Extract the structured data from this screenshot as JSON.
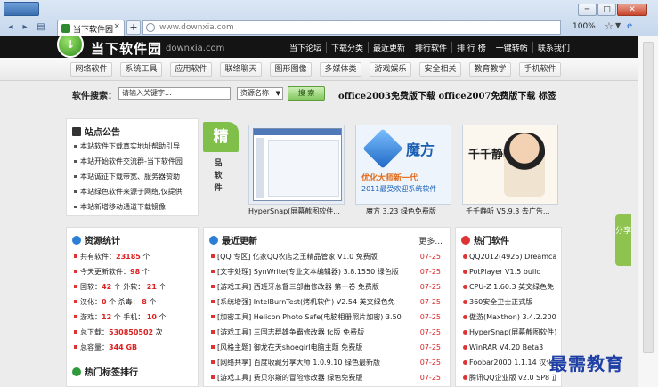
{
  "browser": {
    "tab_title": "当下软件园",
    "tab_close": "×",
    "new_tab": "+",
    "url": "www.downxia.com",
    "zoom": "100%",
    "back_icon": "◂",
    "forward_icon": "▸",
    "window_min": "─",
    "window_max": "□",
    "window_close": "✕"
  },
  "header": {
    "logo_text": "当下软件园",
    "logo_domain": "downxia.com",
    "nav": [
      "当下论坛",
      "下载分类",
      "最近更新",
      "排行软件",
      "排 行 榜",
      "一键转帖",
      "联系我们"
    ]
  },
  "categories": [
    "网络软件",
    "系统工具",
    "应用软件",
    "联络聊天",
    "图形图像",
    "多媒体类",
    "游戏娱乐",
    "安全相关",
    "教育教学",
    "手机软件"
  ],
  "search": {
    "label": "软件搜索：",
    "placeholder": "请输入关键字...",
    "select_value": "资源名称",
    "button": "搜 索",
    "promo": "office2003免费版下载 office2007免费版下载 标签"
  },
  "announcements": {
    "title": "站点公告",
    "items": [
      "本站软件下载真实地址帮助引导",
      "本站开始软件交流群-当下软件园",
      "本站诚征下载带宽、服务器赞助",
      "本站绿色软件来源于网络,仅提供",
      "本站新增移动通道下载镜像"
    ]
  },
  "featured": {
    "badge": "精",
    "vertical_label": "品软件",
    "items": [
      {
        "caption": "HyperSnap(屏幕截图软件..."
      },
      {
        "caption": "魔方 3.23 绿色免费版",
        "title": "魔方",
        "line1": "优化大师新一代",
        "line2": "2011最受欢迎系统软件"
      },
      {
        "caption": "千千静听 V5.9.3 去广告...",
        "title": "千千静听"
      }
    ]
  },
  "stats": {
    "title": "资源统计",
    "rows": [
      {
        "label": "共有软件：",
        "value": "23185",
        "unit": "个"
      },
      {
        "label": "今天更新软件：",
        "value": "98",
        "unit": "个"
      },
      {
        "label": "国软：",
        "value": "42",
        "unit": "个 外软：",
        "value2": "21",
        "unit2": "个"
      },
      {
        "label": "汉化：",
        "value": "0",
        "unit": "个 杀毒：",
        "value2": "8",
        "unit2": "个"
      },
      {
        "label": "游戏：",
        "value": "12",
        "unit": "个 手机：",
        "value2": "10",
        "unit2": "个"
      },
      {
        "label": "总下载：",
        "value": "530850502",
        "unit": "次"
      },
      {
        "label": "总容量：",
        "value": "344 GB",
        "unit": ""
      }
    ]
  },
  "recent": {
    "title": "最近更新",
    "more": "更多...",
    "items": [
      {
        "text": "[QQ 专区] 亿家QQ农店之王精品管家 V1.0 免费版",
        "date": "07-25"
      },
      {
        "text": "[文字处理] SynWrite(专业文本编辑器) 3.8.1550 绿色版",
        "date": "07-25"
      },
      {
        "text": "[游戏工具] 西班牙总督三部曲修改器 第一卷 免费版",
        "date": "07-25"
      },
      {
        "text": "[系统增强] IntelBurnTest(烤机软件) V2.54 英文绿色免",
        "date": "07-25"
      },
      {
        "text": "[加密工具] Helicon Photo Safe(电脑相册照片加密) 3.50",
        "date": "07-25"
      },
      {
        "text": "[游戏工具] 三国志群雄争霸修改器 fc版 免费版",
        "date": "07-25"
      },
      {
        "text": "[风格主题] 御龙在天shoegirl电脑主题 免费版",
        "date": "07-25"
      },
      {
        "text": "[网络共享] 百度收藏分享大师 1.0.9.10 绿色最新版",
        "date": "07-25"
      },
      {
        "text": "[游戏工具] 费贝尔斯的冒险修改器 绿色免费版",
        "date": "07-25"
      }
    ]
  },
  "hot": {
    "title": "热门软件",
    "items": [
      "QQ2012(4925) Dreamcast",
      "PotPlayer V1.5 build",
      "CPU-Z 1.60.3 英文绿色免",
      "360安全卫士正式版",
      "傲游(Maxthon) 3.4.2.2000",
      "HyperSnap(屏幕截图软件)",
      "WinRAR V4.20 Beta3",
      "Foobar2000 1.1.14 汉化",
      "腾讯QQ企业版 v2.0 SP8 正"
    ]
  },
  "tags": {
    "title": "热门标签排行"
  },
  "share": "分享",
  "watermark": "最需教育"
}
